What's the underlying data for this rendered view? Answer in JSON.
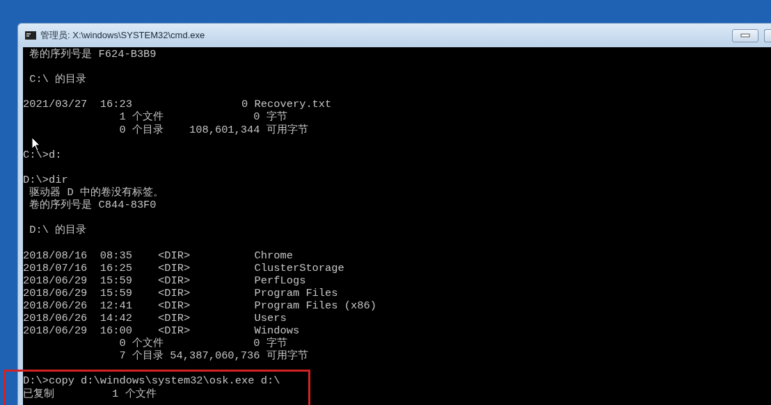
{
  "window": {
    "title": "管理员: X:\\windows\\SYSTEM32\\cmd.exe"
  },
  "console": {
    "blocks": [
      [
        " 卷的序列号是 F624-B3B9"
      ],
      [
        " C:\\ 的目录"
      ],
      [
        "2021/03/27  16:23                 0 Recovery.txt",
        "               1 个文件              0 字节",
        "               0 个目录    108,601,344 可用字节"
      ],
      [
        "C:\\>d:"
      ],
      [
        "D:\\>dir",
        " 驱动器 D 中的卷没有标签。",
        " 卷的序列号是 C844-83F0"
      ],
      [
        " D:\\ 的目录"
      ],
      [
        "2018/08/16  08:35    <DIR>          Chrome",
        "2018/07/16  16:25    <DIR>          ClusterStorage",
        "2018/06/29  15:59    <DIR>          PerfLogs",
        "2018/06/29  15:59    <DIR>          Program Files",
        "2018/06/26  12:41    <DIR>          Program Files (x86)",
        "2018/06/26  14:42    <DIR>          Users",
        "2018/06/29  16:00    <DIR>          Windows",
        "               0 个文件              0 字节",
        "               7 个目录 54,387,060,736 可用字节"
      ],
      [
        "D:\\>copy d:\\windows\\system32\\osk.exe d:\\",
        "已复制         1 个文件"
      ]
    ]
  }
}
